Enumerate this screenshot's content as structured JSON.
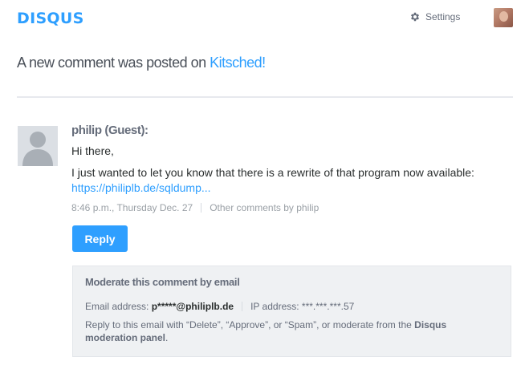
{
  "header": {
    "logo": "DISQUS",
    "settings_label": "Settings"
  },
  "notification": {
    "prefix": "A new comment was posted on ",
    "site_link": "Kitsched!"
  },
  "comment": {
    "author": "philip (Guest):",
    "greeting": "Hi there,",
    "body": "I just wanted to let you know that there is a rewrite of that program now available:",
    "link": "https://philiplb.de/sqldump...",
    "timestamp": "8:46 p.m., Thursday Dec. 27",
    "other_comments": "Other comments by philip",
    "reply_label": "Reply"
  },
  "moderation": {
    "title": "Moderate this comment by email",
    "email_label": "Email address: ",
    "email_value": "p*****@philiplb.de",
    "ip_label": "IP address: ",
    "ip_value": "***.***.***.57",
    "note_text": "Reply to this email with “Delete”, “Approve”, or “Spam”, or moderate from the ",
    "note_link": "Disqus moderation panel",
    "note_end": "."
  },
  "colors": {
    "brand": "#2e9fff",
    "text": "#2a2e2e",
    "muted": "#656c7a",
    "panel_bg": "#eff1f3"
  }
}
